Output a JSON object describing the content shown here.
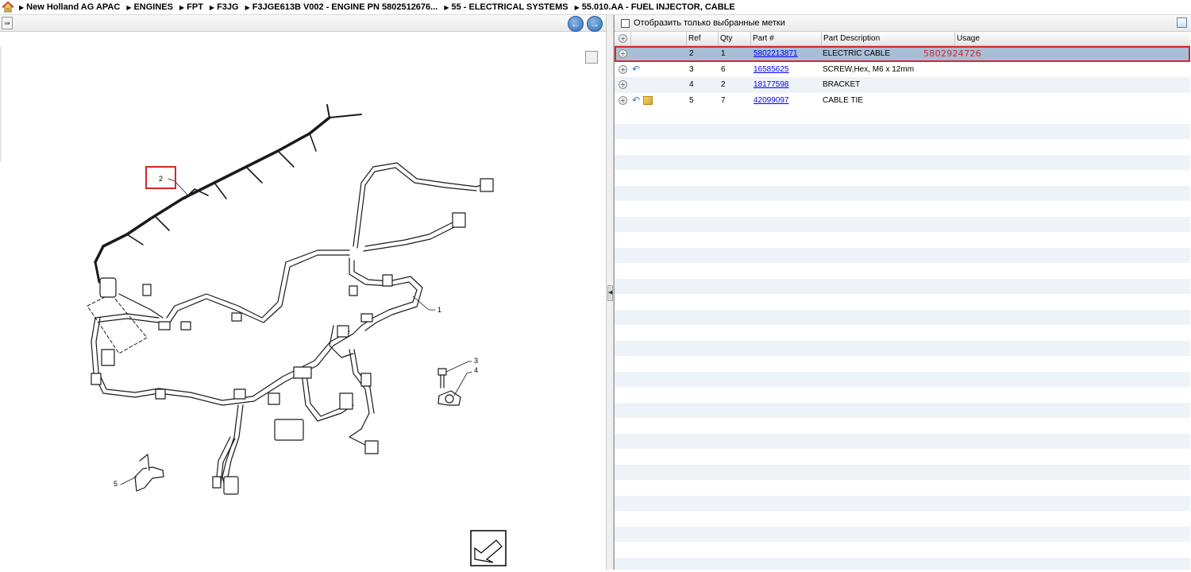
{
  "breadcrumb": {
    "items": [
      "New Holland AG APAC",
      "ENGINES",
      "FPT",
      "F3JG",
      "F3JGE613B V002 - ENGINE PN 5802512676...",
      "55 - ELECTRICAL SYSTEMS",
      "55.010.AA - FUEL INJECTOR, CABLE"
    ]
  },
  "left": {
    "nav_prev": "←",
    "nav_next": "→",
    "toolbar_btn": "⇛"
  },
  "diagram": {
    "callouts": [
      "1",
      "2",
      "3",
      "4",
      "5"
    ]
  },
  "right": {
    "filter_label": "Отобразить только выбранные метки",
    "columns": {
      "ref": "Ref",
      "qty": "Qty",
      "part": "Part #",
      "desc": "Part Description",
      "usage": "Usage"
    },
    "rows": [
      {
        "ref": "2",
        "qty": "1",
        "part": "5802213871",
        "desc": "ELECTRIC CABLE",
        "usage": "",
        "annotation": "5802924726"
      },
      {
        "ref": "3",
        "qty": "6",
        "part": "16585625",
        "desc": "SCREW,Hex, M6 x 12mm",
        "usage": ""
      },
      {
        "ref": "4",
        "qty": "2",
        "part": "18177598",
        "desc": "BRACKET",
        "usage": ""
      },
      {
        "ref": "5",
        "qty": "7",
        "part": "42099097",
        "desc": "CABLE TIE",
        "usage": ""
      }
    ]
  },
  "colors": {
    "highlight": "#d6262a",
    "selected_row": "#a8bed6",
    "link": "#0000ee"
  }
}
